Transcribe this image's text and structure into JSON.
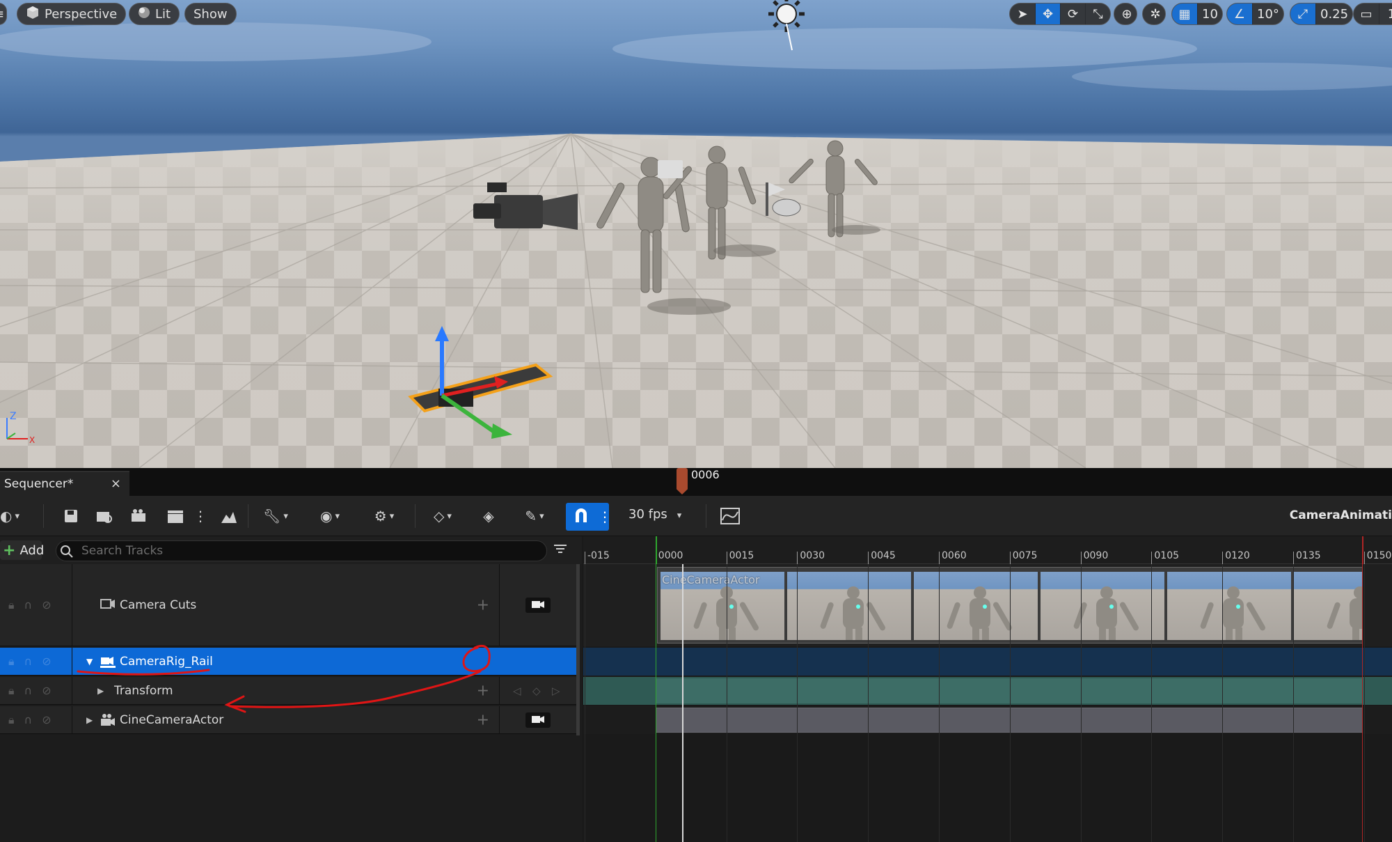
{
  "viewport": {
    "perspective_label": "Perspective",
    "lit_label": "Lit",
    "show_label": "Show",
    "grid_snap_value": "10",
    "rotation_snap_value": "10°",
    "scale_snap_value": "0.25",
    "camera_speed_value": "1"
  },
  "sequencer": {
    "tab_label": "Sequencer*",
    "tab_close": "×",
    "fps_label": "30 fps",
    "sequence_name": "CameraAnimati",
    "add_label": "Add",
    "search_placeholder": "Search Tracks"
  },
  "tracks": [
    {
      "label": "Camera Cuts",
      "has_camera_button": true,
      "selected": false
    },
    {
      "label": "CameraRig_Rail",
      "expanded": true,
      "selected": true
    },
    {
      "label": "Transform",
      "expanded": false,
      "selected": false,
      "keyframe_nav": true
    },
    {
      "label": "CineCameraActor",
      "expanded": false,
      "has_camera_button": true,
      "selected": false
    }
  ],
  "timeline": {
    "playhead_frame": "0006",
    "ticks": [
      "-015",
      "0000",
      "0015",
      "0030",
      "0045",
      "0060",
      "0075",
      "0090",
      "0105",
      "0120",
      "0135",
      "0150"
    ],
    "camera_cut_section_label": "CineCameraActor"
  },
  "colors": {
    "selection_blue": "#0d69d6",
    "playhead": "#a94a2e",
    "transform_track": "#2f5a54",
    "annotation_red": "#e01515"
  }
}
